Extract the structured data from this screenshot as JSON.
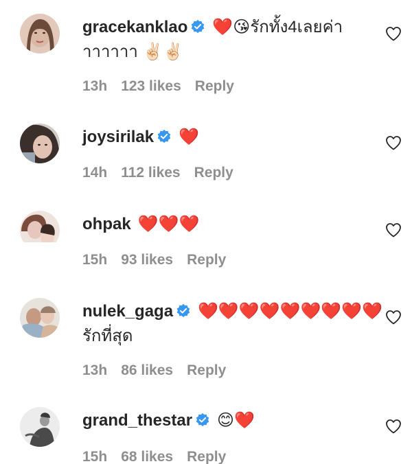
{
  "comments": [
    {
      "username": "gracekanklao",
      "verified": true,
      "text": "❤️😘รักทั้ง4เลยค่า",
      "text_line2": "าาาาาา ✌🏻✌🏻",
      "time": "13h",
      "likes": "123 likes",
      "reply": "Reply",
      "avatar_colors": [
        "#d9b8a6",
        "#6b4a3a"
      ]
    },
    {
      "username": "joysirilak",
      "verified": true,
      "text": "❤️",
      "text_line2": "",
      "time": "14h",
      "likes": "112 likes",
      "reply": "Reply",
      "avatar_colors": [
        "#c9c2c0",
        "#3b2f2b"
      ]
    },
    {
      "username": "ohpak",
      "verified": false,
      "text": "❤️❤️❤️",
      "text_line2": "",
      "time": "15h",
      "likes": "93 likes",
      "reply": "Reply",
      "avatar_colors": [
        "#e7c6bd",
        "#7a4c3c"
      ]
    },
    {
      "username": "nulek_gaga",
      "verified": true,
      "text": "❤️❤️❤️❤️❤️❤️❤️❤️❤️",
      "text_line2": "รักที่สุด",
      "time": "13h",
      "likes": "86 likes",
      "reply": "Reply",
      "avatar_colors": [
        "#d9cfc6",
        "#9a7d6a"
      ]
    },
    {
      "username": "grand_thestar",
      "verified": true,
      "text": "😊❤️",
      "text_line2": "",
      "time": "15h",
      "likes": "68 likes",
      "reply": "Reply",
      "avatar_colors": [
        "#e6e6e6",
        "#4a4a4a"
      ]
    }
  ],
  "colors": {
    "verified": "#3897f0",
    "meta": "#8e8e8e",
    "text": "#262626"
  }
}
